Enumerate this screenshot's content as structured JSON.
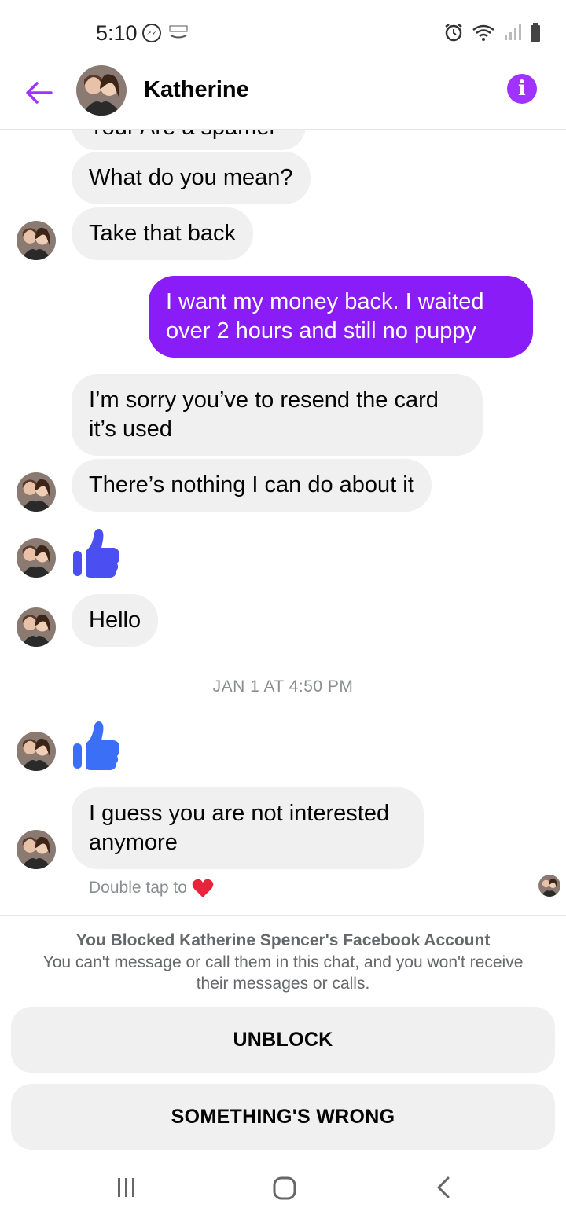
{
  "status_bar": {
    "time": "5:10",
    "icons": [
      "messenger-icon",
      "amazon-icon",
      "alarm-icon",
      "wifi-icon",
      "signal-icon",
      "battery-icon"
    ]
  },
  "header": {
    "contact_name": "Katherine",
    "icons": [
      "back-arrow-icon",
      "info-icon"
    ],
    "accent_color": "#a033ff"
  },
  "messages": [
    {
      "id": "m0",
      "direction": "in",
      "text": "Your Are a spamer"
    },
    {
      "id": "m1",
      "direction": "in",
      "text": "What do you mean?"
    },
    {
      "id": "m2",
      "direction": "in",
      "text": "Take that back"
    },
    {
      "id": "m3",
      "direction": "out",
      "text": "I want my money back. I waited over 2 hours and still no puppy"
    },
    {
      "id": "m4",
      "direction": "in",
      "text": "I’m sorry you’ve to resend the card it’s used"
    },
    {
      "id": "m5",
      "direction": "in",
      "text": "There’s nothing I can do about it"
    },
    {
      "id": "m6",
      "direction": "in",
      "type": "like",
      "icon": "thumbs-up-icon"
    },
    {
      "id": "m7",
      "direction": "in",
      "text": "Hello"
    },
    {
      "id": "m8",
      "direction": "in",
      "type": "like",
      "icon": "thumbs-up-icon"
    },
    {
      "id": "m9",
      "direction": "in",
      "text": "I guess you are not interested anymore"
    }
  ],
  "timestamp": "JAN 1 AT 4:50 PM",
  "double_tap_hint": "Double tap to",
  "blocked": {
    "title": "You Blocked Katherine Spencer's Facebook Account",
    "description": "You can't message or call them in this chat, and you won't receive their messages or calls.",
    "unblock_label": "UNBLOCK",
    "wrong_label": "SOMETHING'S WRONG"
  },
  "colors": {
    "outgoing_bubble": "#8a1df7",
    "incoming_bubble": "#f0f0f0",
    "like_early": "#4b4ef0",
    "like_late": "#3b6ff5"
  },
  "nav_bar": {
    "icons": [
      "recent-apps-icon",
      "home-icon",
      "back-icon"
    ]
  }
}
